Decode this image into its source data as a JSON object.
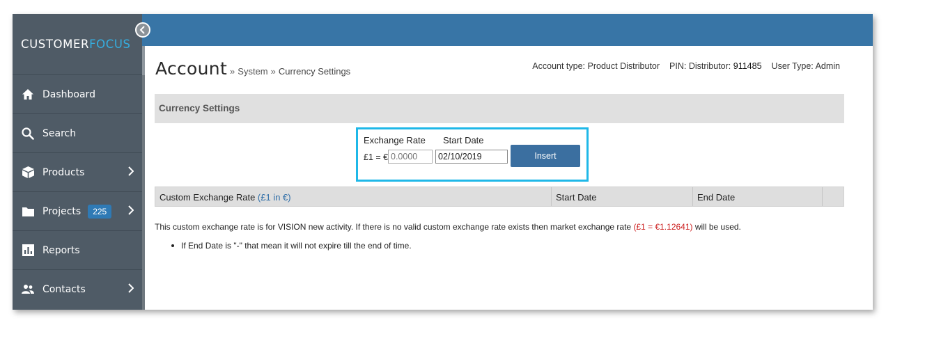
{
  "brand": {
    "part1": "CUSTOMER",
    "part2": "FOCUS",
    "accent_color": "#35aee0"
  },
  "sidebar": {
    "items": [
      {
        "label": "Dashboard",
        "icon": "home-icon"
      },
      {
        "label": "Search",
        "icon": "search-icon"
      },
      {
        "label": "Products",
        "icon": "box-icon"
      },
      {
        "label": "Projects",
        "icon": "folder-icon",
        "badge": "225"
      },
      {
        "label": "Reports",
        "icon": "bar-chart-icon"
      },
      {
        "label": "Contacts",
        "icon": "people-icon"
      }
    ]
  },
  "header": {
    "title": "Account",
    "sep": "»",
    "crumb1": "System",
    "crumb2": "Currency Settings"
  },
  "account_info": {
    "account_type_label": "Account type:",
    "account_type_value": "Product Distributor",
    "pin_label": "PIN:",
    "pin_prefix": "Distributor:",
    "pin_value": "911485",
    "user_type_label": "User Type:",
    "user_type_value": "Admin"
  },
  "section": {
    "title": "Currency Settings"
  },
  "form": {
    "exchange_rate_label": "Exchange Rate",
    "start_date_label": "Start Date",
    "prefix": "£1 = €",
    "rate_placeholder": "0.0000",
    "start_date_value": "02/10/2019",
    "insert_label": "Insert",
    "highlight_color": "#1fb8e8"
  },
  "table": {
    "col1": "Custom Exchange Rate",
    "col1_unit": "(£1 in €)",
    "col2": "Start Date",
    "col3": "End Date"
  },
  "note": {
    "text_before": "This custom exchange rate is for VISION new activity. If there is no valid custom exchange rate exists then market exchange rate",
    "rate": "(£1 = €1.12641)",
    "text_after": "will be used."
  },
  "bullet": {
    "text": "If End Date is \"-\" that mean it will not expire till the end of time."
  },
  "colors": {
    "topbar": "#3875a6",
    "sidebar": "#4f5b66",
    "button": "#3b6fa0",
    "warning": "#cc1f1f"
  }
}
